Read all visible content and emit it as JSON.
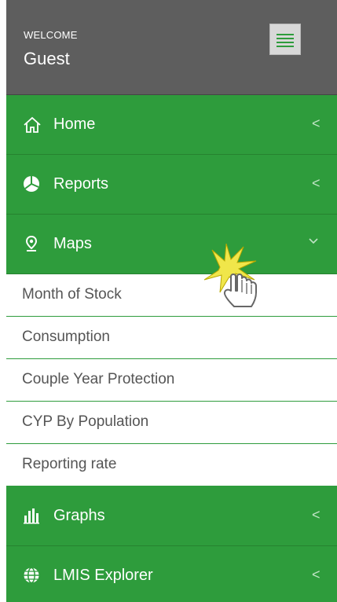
{
  "header": {
    "welcome": "WELCOME",
    "username": "Guest",
    "menu_icon": "hamburger-icon"
  },
  "nav": [
    {
      "label": "Home",
      "icon": "home-icon",
      "state": "collapsed"
    },
    {
      "label": "Reports",
      "icon": "pie-chart-icon",
      "state": "collapsed"
    },
    {
      "label": "Maps",
      "icon": "map-pin-icon",
      "state": "expanded"
    },
    {
      "label": "Graphs",
      "icon": "bar-chart-icon",
      "state": "collapsed"
    },
    {
      "label": "LMIS Explorer",
      "icon": "globe-icon",
      "state": "collapsed"
    }
  ],
  "maps_submenu": [
    {
      "label": "Month of Stock"
    },
    {
      "label": "Consumption"
    },
    {
      "label": "Couple Year Protection"
    },
    {
      "label": "CYP By Population"
    },
    {
      "label": "Reporting rate"
    }
  ],
  "colors": {
    "nav_green": "#2e9c3c",
    "header_gray": "#5e5e5e",
    "submenu_text": "#555555"
  }
}
